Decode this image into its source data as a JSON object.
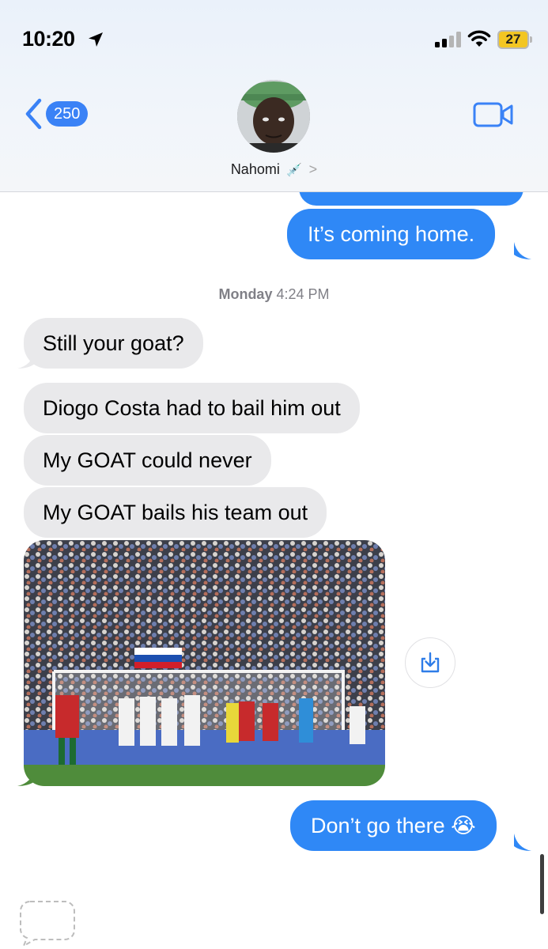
{
  "status_bar": {
    "time": "10:20",
    "battery": "27"
  },
  "header": {
    "back_count": "250",
    "contact_name": "Nahomi",
    "contact_emoji": "💉",
    "contact_chevron": ">"
  },
  "messages": {
    "sent_1": "It’s coming home.",
    "timestamp_day": "Monday",
    "timestamp_time": "4:24 PM",
    "received_1": "Still your goat?",
    "received_2": "Diogo Costa had to bail him out",
    "received_3": "My GOAT could never",
    "received_4": "My GOAT bails his team out",
    "sent_2": "Don’t go there 😭"
  },
  "colors": {
    "sent_bubble": "#2f88f6",
    "received_bubble": "#e9e9eb",
    "accent": "#3a82f6"
  }
}
